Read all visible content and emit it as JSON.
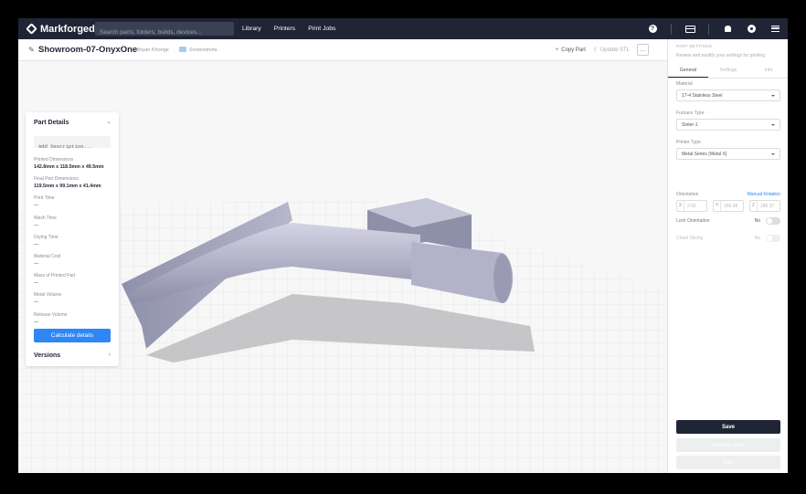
{
  "topnav": {
    "brand": "Markforged",
    "search_placeholder": "Search parts, folders, builds, devices...",
    "links": [
      "Library",
      "Printers",
      "Print Jobs"
    ],
    "icons": [
      "help-icon",
      "card-icon",
      "bell-icon",
      "user-icon",
      "menu-icon"
    ],
    "bg_color": "#1f2535"
  },
  "subheader": {
    "title": "Showroom-07-OnyxOne",
    "owner": "Bryan Khonge",
    "folder": "Screenshots",
    "copy_part": "Copy Part",
    "update_stl": "Update STL",
    "more": "…"
  },
  "details": {
    "title": "Part Details",
    "description_placeholder": "Add Description...",
    "rows": [
      {
        "label": "Printed Dimensions",
        "value": "142.8mm x 118.5mm x 49.5mm"
      },
      {
        "label": "Final Part Dimensions",
        "value": "119.5mm x 99.1mm x 41.4mm"
      },
      {
        "label": "Print Time",
        "value": "---"
      },
      {
        "label": "Wash Time",
        "value": "---"
      },
      {
        "label": "Drying Time",
        "value": "---"
      },
      {
        "label": "Material Cost",
        "value": "---"
      },
      {
        "label": "Mass of Printed Part",
        "value": "---"
      },
      {
        "label": "Metal Volume",
        "value": "---"
      },
      {
        "label": "Release Volume",
        "value": "---"
      }
    ],
    "calc_button": "Calculate details",
    "versions": "Versions"
  },
  "settings": {
    "title": "PART SETTINGS",
    "subtitle": "Review and modify your settings for printing",
    "tabs": [
      "General",
      "Settings",
      "Info"
    ],
    "material_label": "Material",
    "material_value": "17-4 Stainless Steel",
    "furnace_label": "Furnace Type",
    "furnace_value": "Sinter-1",
    "printer_label": "Printer Type",
    "printer_value": "Metal Series (Metal X)",
    "orientation_label": "Orientation",
    "manual_rotation": "Manual Rotation",
    "coords": [
      {
        "axis": "X",
        "value": "2.66"
      },
      {
        "axis": "Y",
        "value": "349.48"
      },
      {
        "axis": "Z",
        "value": "180.37"
      }
    ],
    "lock_orientation": "Lock Orientation",
    "lock_value": "No",
    "cloud_slicing": "Cloud Slicing",
    "cloud_value": "No",
    "save": "Save",
    "internal_view": "Internal View",
    "print": "Print",
    "accent": "#2f86f6"
  }
}
